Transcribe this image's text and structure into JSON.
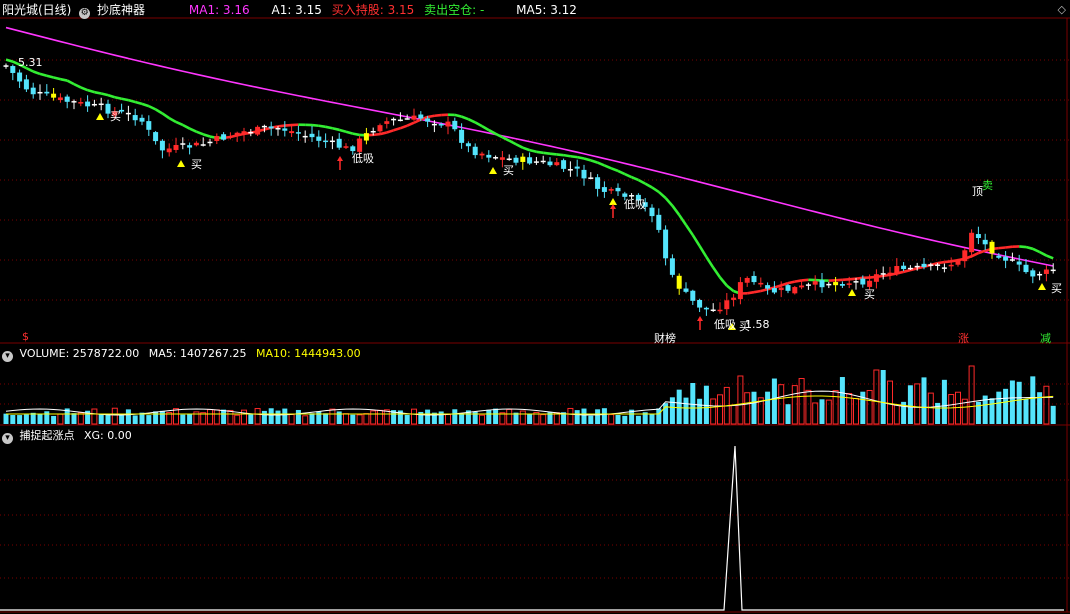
{
  "colors": {
    "bg": "#000000",
    "grid": "#7a0000",
    "up": "#ff2a2a",
    "down": "#54e4fc",
    "flat": "#ffffff",
    "yellow": "#ffff00",
    "magenta": "#ff36ff",
    "green": "#33ee33",
    "vol_ma5": "#ffffff",
    "vol_ma10": "#ffff00"
  },
  "main_header": {
    "stock_name": "阳光城(日线)",
    "indicator_name": "抄底神器",
    "items": [
      {
        "label": "MA1: 3.16",
        "color": "#ff36ff"
      },
      {
        "label": "A1: 3.15",
        "color": "#ffffff"
      },
      {
        "label": "买入持股: 3.15",
        "color": "#ff3030"
      },
      {
        "label": "卖出空仓: -",
        "color": "#33ee33"
      },
      {
        "label": "MA5: 3.12",
        "color": "#ffffff"
      }
    ],
    "corner_icon": "diamond-settings-icon"
  },
  "price_label": "5.31",
  "markers": [
    {
      "text": "买",
      "color": "#ffffff"
    },
    {
      "text": "低吸",
      "color": "#ffffff"
    },
    {
      "text": "顶",
      "color": "#ffffff"
    },
    {
      "text": "卖",
      "color": "#33ee33"
    },
    {
      "text": "$",
      "color": "#ff3030"
    },
    {
      "text": "财榜",
      "color": "#ffffff"
    },
    {
      "text": "涨",
      "color": "#ff3030"
    },
    {
      "text": "减",
      "color": "#33ee33"
    },
    {
      "text": "1.58",
      "color": "#ffffff"
    }
  ],
  "volume_header": {
    "label": "VOLUME: 2578722.00",
    "ma5": "MA5: 1407267.25",
    "ma10": "MA10: 1444943.00"
  },
  "xg_header": {
    "label": "捕捉起涨点",
    "xg": "XG: 0.00"
  }
}
